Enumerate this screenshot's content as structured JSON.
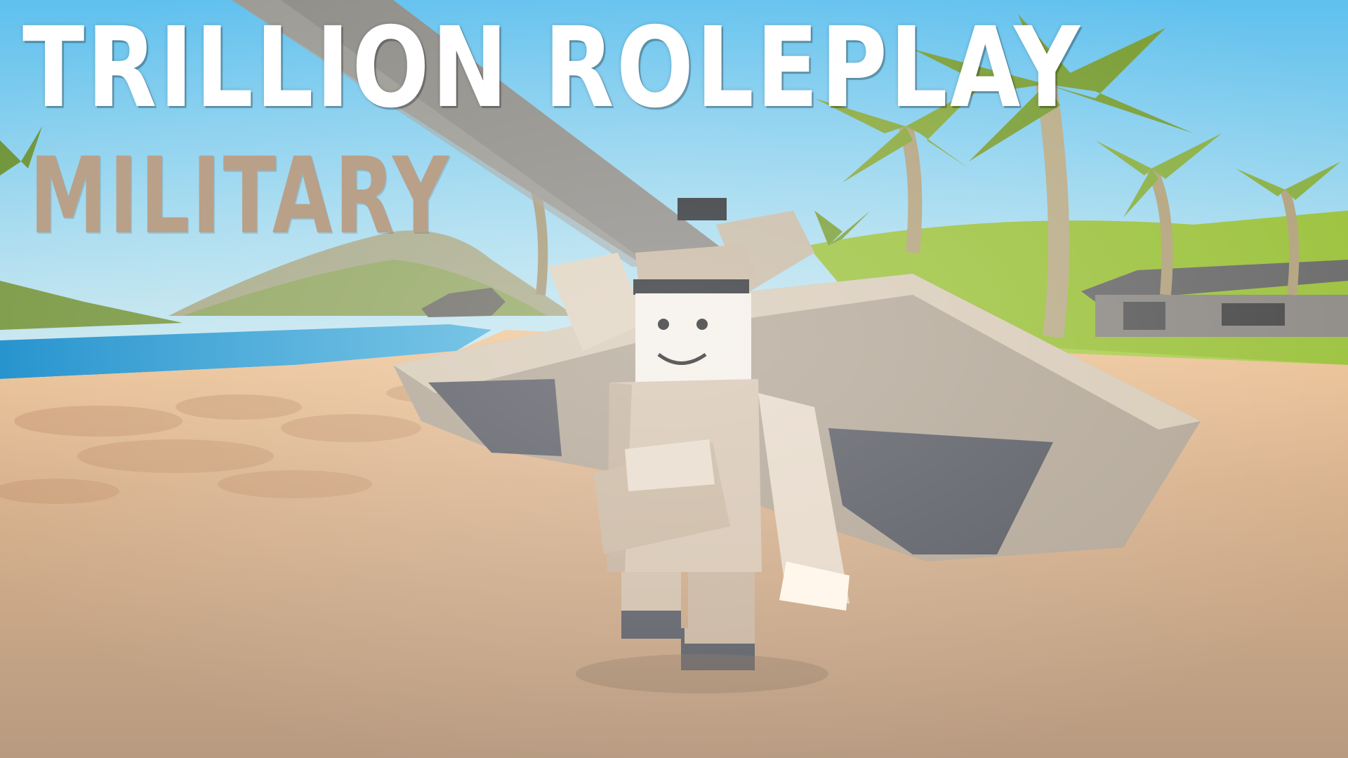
{
  "title": {
    "line1": "TRILLION ROLEPLAY",
    "line2": "MILITARY"
  },
  "colors": {
    "sky": "#7cc7e8",
    "sand": "#c9a98a",
    "water": "#2f9fd4",
    "grass": "#9cc23d",
    "uniform": "#d8c4ae",
    "title_main": "#ffffff",
    "title_sub": "#b9a089"
  },
  "scene": {
    "character_icon": "soldier-character",
    "vehicle_icon": "aircraft-wing",
    "patch_icon": "flag-patch"
  }
}
